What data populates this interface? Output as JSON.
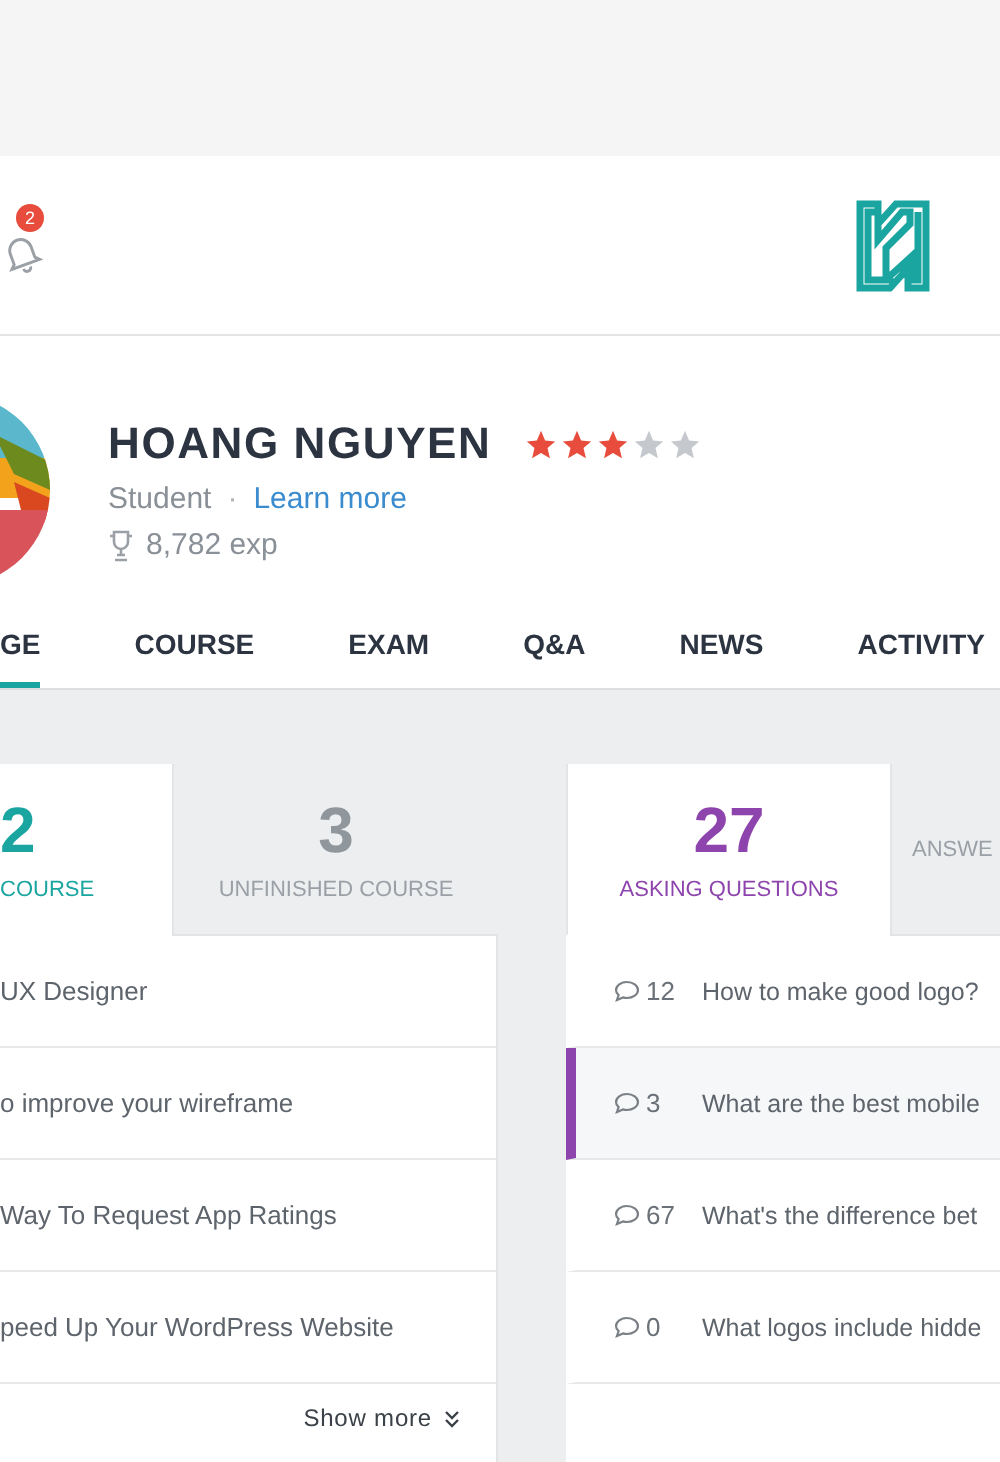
{
  "notifications": {
    "badge": "2"
  },
  "profile": {
    "name": "HOANG NGUYEN",
    "stars": 3,
    "role": "Student",
    "separator": "·",
    "link": "Learn more",
    "exp": "8,782 exp"
  },
  "tabs": [
    {
      "label": "GE",
      "selected": true
    },
    {
      "label": "COURSE",
      "selected": false
    },
    {
      "label": "EXAM",
      "selected": false
    },
    {
      "label": "Q&A",
      "selected": false
    },
    {
      "label": "NEWS",
      "selected": false
    },
    {
      "label": "ACTIVITY",
      "selected": false
    }
  ],
  "courses": {
    "tabs": [
      {
        "count": "2",
        "label": "COURSE",
        "selected": true
      },
      {
        "count": "3",
        "label": "UNFINISHED COURSE",
        "selected": false
      }
    ],
    "rows": [
      "UX Designer",
      "o improve your wireframe",
      "Way To Request App Ratings",
      "peed Up Your WordPress Website"
    ],
    "show_more": "Show more"
  },
  "questions": {
    "tabs": [
      {
        "count": "27",
        "label": "ASKING QUESTIONS",
        "selected": true
      },
      {
        "label": "ANSWE",
        "selected": false
      }
    ],
    "rows": [
      {
        "comments": "12",
        "title": "How to make good logo?",
        "selected": false
      },
      {
        "comments": "3",
        "title": "What are the best mobile",
        "selected": true
      },
      {
        "comments": "67",
        "title": "What's the difference bet",
        "selected": false
      },
      {
        "comments": "0",
        "title": "What logos include hidde",
        "selected": false
      }
    ]
  }
}
